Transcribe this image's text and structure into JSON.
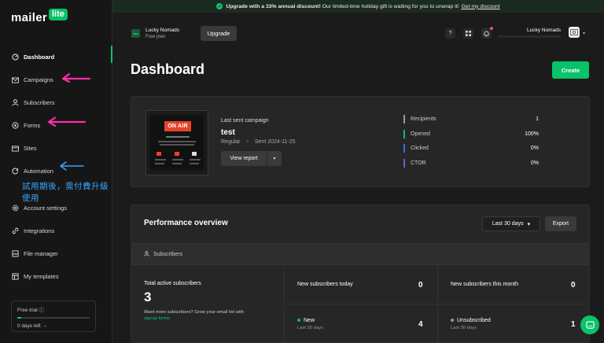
{
  "colors": {
    "accent": "#09c269",
    "annotation_pink": "#ff2fa8",
    "annotation_blue": "#3aa6ff"
  },
  "logo": {
    "text": "mailer",
    "badge": "lite"
  },
  "sidebar": {
    "items": [
      {
        "label": "Dashboard",
        "icon": "dashboard-icon"
      },
      {
        "label": "Campaigns",
        "icon": "mail-icon"
      },
      {
        "label": "Subscribers",
        "icon": "user-icon"
      },
      {
        "label": "Forms",
        "icon": "forms-icon"
      },
      {
        "label": "Sites",
        "icon": "sites-icon"
      },
      {
        "label": "Automation",
        "icon": "automation-icon"
      },
      {
        "label": "Account settings",
        "icon": "settings-icon"
      },
      {
        "label": "Integrations",
        "icon": "link-icon"
      },
      {
        "label": "File manager",
        "icon": "file-icon"
      },
      {
        "label": "My templates",
        "icon": "template-icon"
      }
    ],
    "annotation": "試用期後，需付費升級使用",
    "trial": {
      "label": "Free trial",
      "progress": 0.05,
      "days_left": "0 days left"
    }
  },
  "banner": {
    "bold": "Upgrade with a 33% annual discount!",
    "text": "Our limited-time holiday gift is waiting for you to unwrap it!",
    "link": "Get my discount"
  },
  "topbar": {
    "account_name": "Lucky Nomads",
    "account_plan": "Free plan",
    "upgrade_label": "Upgrade",
    "user_name": "Lucky Nomads"
  },
  "main": {
    "title": "Dashboard",
    "create_label": "Create",
    "last_campaign": {
      "label": "Last sent campaign",
      "name": "test",
      "type": "Regular",
      "sent": "Sent 2024-11-25",
      "view_report": "View report",
      "thumb_title": "ON AIR",
      "stats": [
        {
          "label": "Recipients",
          "value": "1",
          "color": "#9a9a9a"
        },
        {
          "label": "Opened",
          "value": "100%",
          "color": "#09c269"
        },
        {
          "label": "Clicked",
          "value": "0%",
          "color": "#3b6fd8"
        },
        {
          "label": "CTOR",
          "value": "0%",
          "color": "#8a4fd6"
        }
      ]
    },
    "performance": {
      "title": "Performance overview",
      "range": "Last 30 days",
      "export_label": "Export",
      "section": "Subscribers",
      "total_label": "Total active subscribers",
      "total_value": "3",
      "help": "Want more subscribers? Grow your email list with",
      "help_link": "signup forms",
      "today_label": "New subscribers today",
      "today_value": "0",
      "month_label": "New subscribers this month",
      "month_value": "0",
      "new_label": "New",
      "new_sub": "Last 30 days",
      "new_value": "4",
      "unsub_label": "Unsubscribed",
      "unsub_sub": "Last 30 days",
      "unsub_value": "1"
    }
  }
}
